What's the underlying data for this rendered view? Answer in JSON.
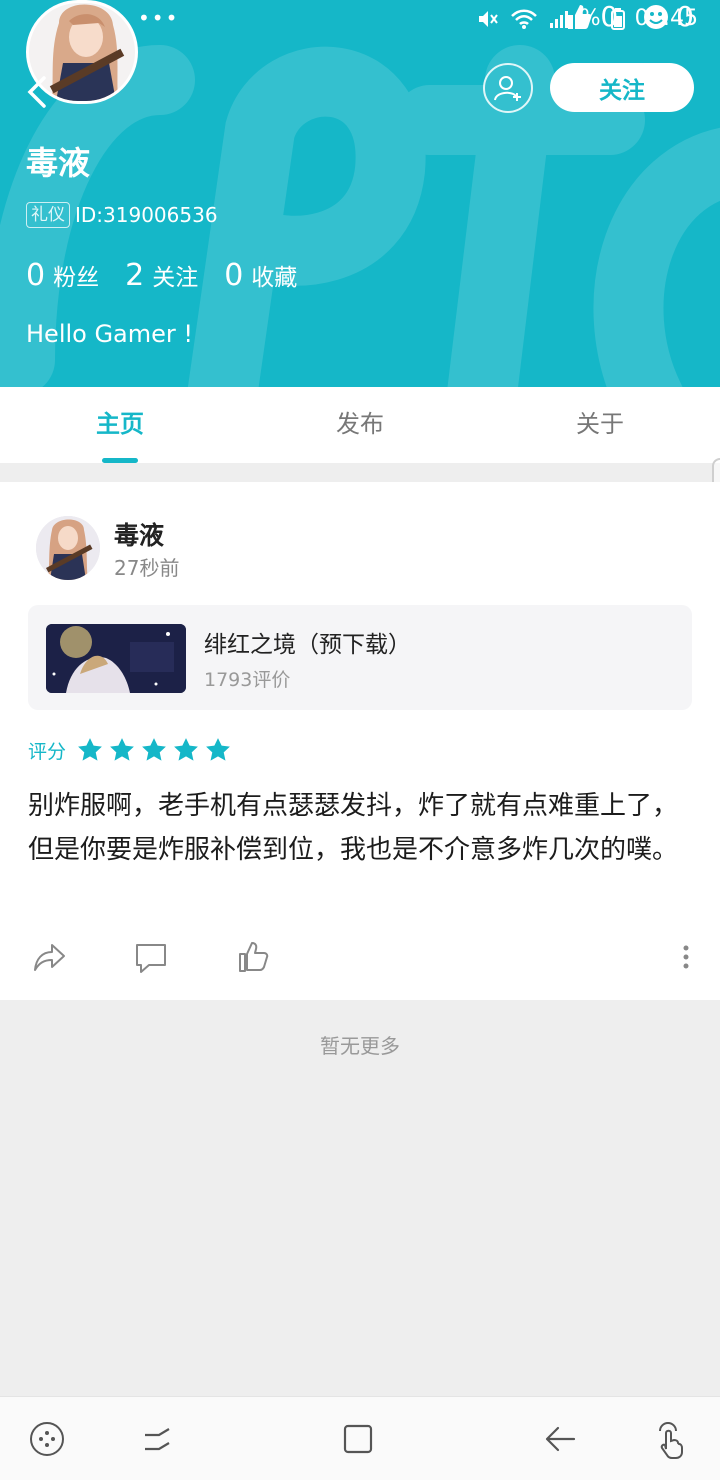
{
  "theme": {
    "accent": "#15b7c8",
    "page_bg": "#eeeeee"
  },
  "status_bar": {
    "time": "02:45",
    "dots": "•••",
    "likes_count": "0",
    "smiles_count": "0",
    "battery_text": "%"
  },
  "profile": {
    "name": "毒液",
    "badge": "礼仪",
    "id_text": "ID:319006536",
    "stats": [
      {
        "num": "0",
        "label": "粉丝"
      },
      {
        "num": "2",
        "label": "关注"
      },
      {
        "num": "0",
        "label": "收藏"
      }
    ],
    "bio": "Hello Gamer !",
    "follow_label": "关注"
  },
  "tabs": [
    {
      "label": "主页",
      "active": true
    },
    {
      "label": "发布",
      "active": false
    },
    {
      "label": "关于",
      "active": false
    }
  ],
  "post": {
    "author": "毒液",
    "time": "27秒前",
    "game": {
      "name": "绯红之境（预下载）",
      "reviews": "1793评价"
    },
    "rating_label": "评分",
    "rating": 5,
    "rating_max": 5,
    "text": "别炸服啊，老手机有点瑟瑟发抖，炸了就有点难重上了，但是你要是炸服补偿到位，我也是不介意多炸几次的噗。"
  },
  "footer_text": "暂无更多",
  "icons": [
    "back-icon",
    "add-friend-icon",
    "star-icon",
    "share-icon",
    "comment-icon",
    "like-icon",
    "more-icon",
    "game-tools-icon",
    "recents-icon",
    "home-icon",
    "back-nav-icon",
    "touch-icon"
  ]
}
